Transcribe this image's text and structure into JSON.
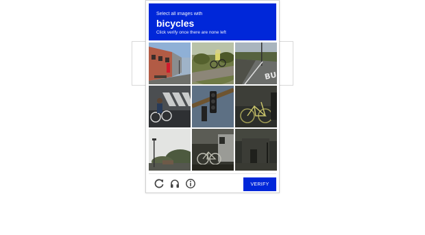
{
  "challenge": {
    "prompt": "Select all images with",
    "target": "bicycles",
    "subtext": "Click verify once there are none left",
    "header_color": "#0027d9"
  },
  "tiles": [
    {
      "name": "tile-street-building"
    },
    {
      "name": "tile-cyclist-hill"
    },
    {
      "name": "tile-road-marking"
    },
    {
      "name": "tile-crosswalk-bicycle"
    },
    {
      "name": "tile-traffic-light"
    },
    {
      "name": "tile-parked-bicycle"
    },
    {
      "name": "tile-streetlight"
    },
    {
      "name": "tile-bicycle-wall"
    },
    {
      "name": "tile-dark-building"
    }
  ],
  "footer": {
    "reload_icon": "reload-icon",
    "audio_icon": "headphones-icon",
    "info_icon": "info-icon",
    "verify_label": "VERIFY"
  }
}
